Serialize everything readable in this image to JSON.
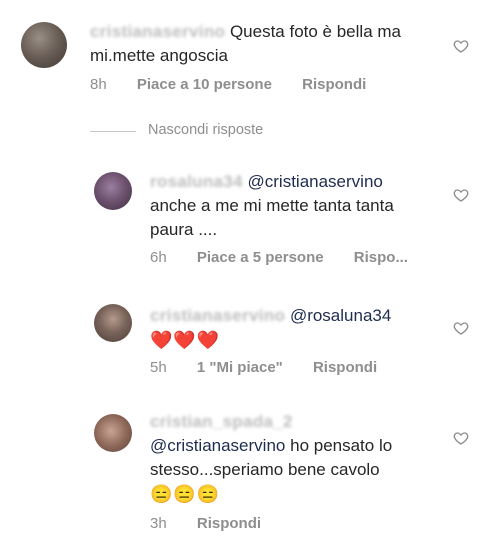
{
  "comments": [
    {
      "username": "cristianaservino",
      "text": "Questa foto è bella ma mi.mette angoscia",
      "time": "8h",
      "likes": "Piace a 10 persone",
      "reply": "Rispondi"
    },
    {
      "username": "rosaluna34",
      "mention": "@cristianaservino",
      "text": "anche a me mi mette tanta tanta paura ....",
      "time": "6h",
      "likes": "Piace a 5 persone",
      "reply": "Rispo..."
    },
    {
      "username": "cristianaservino",
      "mention": "@rosaluna34",
      "text": "❤️❤️❤️",
      "time": "5h",
      "likes": "1 \"Mi piace\"",
      "reply": "Rispondi"
    },
    {
      "username": "cristian_spada_2",
      "mention": "@cristianaservino",
      "text": "ho pensato lo stesso...speriamo bene cavolo",
      "emoji": "😑😑😑",
      "time": "3h",
      "reply": "Rispondi"
    }
  ],
  "hide_replies": "Nascondi risposte",
  "icons": {
    "like": "heart-outline-icon"
  }
}
